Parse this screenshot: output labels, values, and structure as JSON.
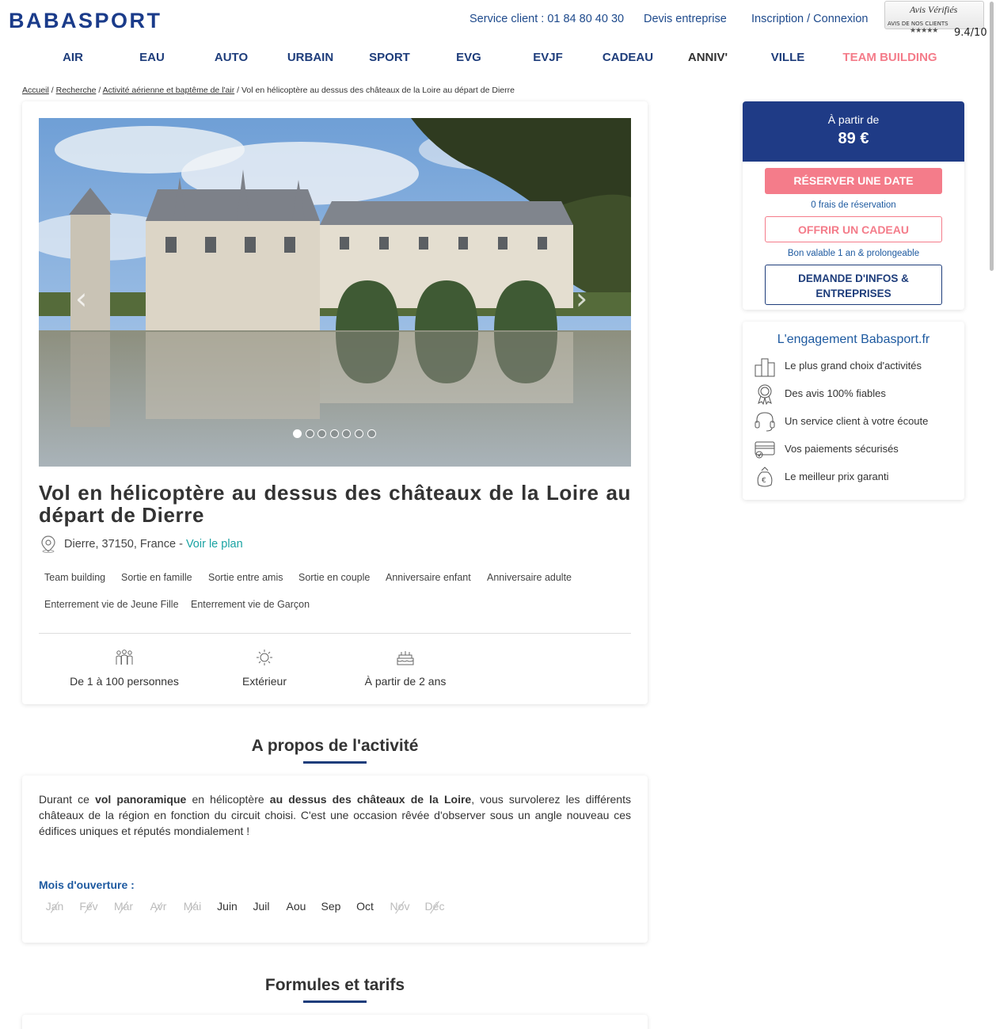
{
  "header": {
    "logo": "BABASPORT",
    "service_client": "Service client : 01 84 80 40 30",
    "devis": "Devis entreprise",
    "login": "Inscription / Connexion",
    "avis": {
      "title": "Avis Vérifiés",
      "subtitle": "AVIS DE NOS CLIENTS",
      "stars": "★★★★★",
      "score": "9.4/10"
    }
  },
  "nav": [
    "AIR",
    "EAU",
    "AUTO",
    "URBAIN",
    "SPORT",
    "EVG",
    "EVJF",
    "CADEAU",
    "ANNIV'",
    "VILLE",
    "TEAM BUILDING"
  ],
  "breadcrumb": {
    "items": [
      "Accueil",
      "Recherche",
      "Activité aérienne et baptême de l'air"
    ],
    "current": "Vol en hélicoptère au dessus des châteaux de la Loire au départ de Dierre",
    "separator": " / "
  },
  "gallery": {
    "prev_icon": "chevron-left-icon",
    "next_icon": "chevron-right-icon",
    "dot_count": 7,
    "active_index": 0
  },
  "activity": {
    "title": "Vol en hélicoptère au dessus des châteaux de la Loire au départ de Dierre",
    "location": "Dierre, 37150, France - ",
    "map_link": "Voir le plan",
    "tags": [
      "Team building",
      "Sortie en famille",
      "Sortie entre amis",
      "Sortie en couple",
      "Anniversaire enfant",
      "Anniversaire adulte",
      "Enterrement vie de Jeune Fille",
      "Enterrement vie de Garçon"
    ],
    "features": [
      {
        "icon": "group-icon",
        "label": "De 1 à 100 personnes"
      },
      {
        "icon": "sun-icon",
        "label": "Extérieur"
      },
      {
        "icon": "cake-icon",
        "label": "À partir de 2 ans"
      }
    ]
  },
  "about": {
    "heading": "A propos de l'activité",
    "desc_parts": [
      "Durant ce ",
      "vol panoramique",
      " en hélicoptère ",
      "au dessus des châteaux de la Loire",
      ", vous survolerez les différents châteaux de la région en fonction du circuit choisi. C'est une occasion rêvée d'observer sous un angle nouveau ces édifices uniques et réputés mondialement !"
    ],
    "months_label": "Mois d'ouverture :",
    "months": [
      {
        "name": "Jan",
        "open": false
      },
      {
        "name": "Fév",
        "open": false
      },
      {
        "name": "Mar",
        "open": false
      },
      {
        "name": "Avr",
        "open": false
      },
      {
        "name": "Mai",
        "open": false
      },
      {
        "name": "Juin",
        "open": true
      },
      {
        "name": "Juil",
        "open": true
      },
      {
        "name": "Aou",
        "open": true
      },
      {
        "name": "Sep",
        "open": true
      },
      {
        "name": "Oct",
        "open": true
      },
      {
        "name": "Nov",
        "open": false
      },
      {
        "name": "Déc",
        "open": false
      }
    ]
  },
  "formules": {
    "heading": "Formules et tarifs"
  },
  "sidebar": {
    "price_from": "À partir de",
    "price": "89 €",
    "reserve": "RÉSERVER UNE DATE",
    "reserve_note": "0 frais de réservation",
    "gift": "OFFRIR UN CADEAU",
    "gift_note": "Bon valable 1 an & prolongeable",
    "info": "DEMANDE D'INFOS & ENTREPRISES",
    "engagement_title": "L'engagement Babasport.fr",
    "engagements": [
      {
        "icon": "podium-icon",
        "label": "Le plus grand choix d'activités"
      },
      {
        "icon": "award-icon",
        "label": "Des avis 100% fiables"
      },
      {
        "icon": "headset-icon",
        "label": "Un service client à votre écoute"
      },
      {
        "icon": "credit-card-icon",
        "label": "Vos paiements sécurisés"
      },
      {
        "icon": "money-bag-icon",
        "label": "Le meilleur prix garanti"
      }
    ]
  },
  "colors": {
    "brand_blue": "#1f3b86",
    "accent_pink": "#f47c8a",
    "link_teal": "#1aa3a3"
  }
}
